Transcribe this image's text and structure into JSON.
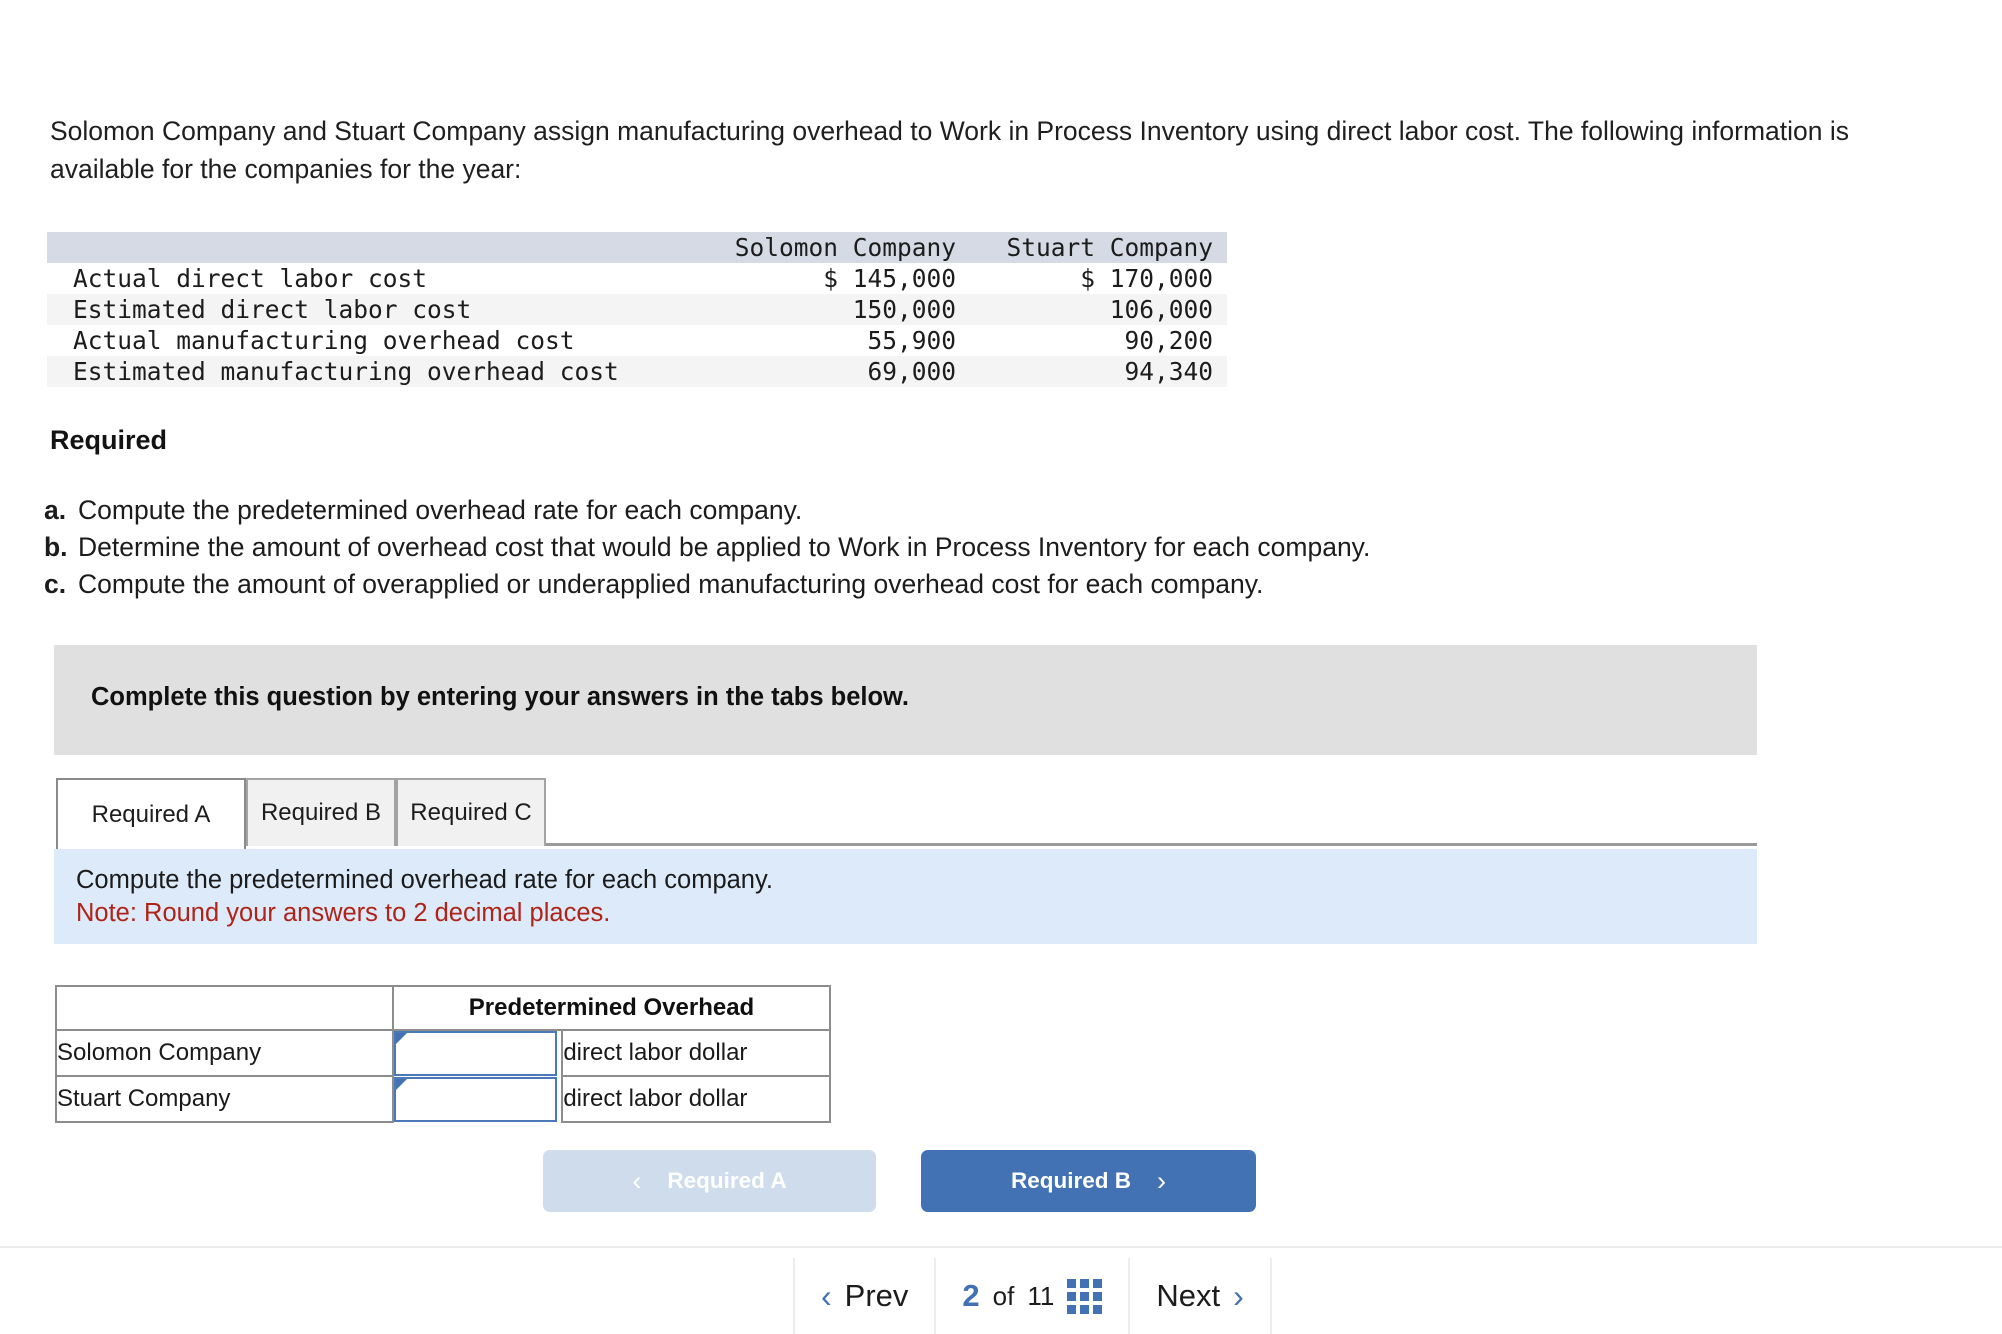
{
  "intro": {
    "paragraph": "Solomon Company and Stuart Company assign manufacturing overhead to Work in Process Inventory using direct labor cost. The following information is available for the companies for the year:"
  },
  "fact_table": {
    "columns": [
      "",
      "Solomon Company",
      "Stuart Company"
    ],
    "rows": [
      {
        "label": "Actual direct labor cost",
        "solomon": "$ 145,000",
        "stuart": "$ 170,000"
      },
      {
        "label": "Estimated direct labor cost",
        "solomon": "150,000",
        "stuart": "106,000"
      },
      {
        "label": "Actual manufacturing overhead cost",
        "solomon": "55,900",
        "stuart": "90,200"
      },
      {
        "label": "Estimated manufacturing overhead cost",
        "solomon": "69,000",
        "stuart": "94,340"
      }
    ]
  },
  "required": {
    "title": "Required",
    "items": [
      {
        "letter": "a.",
        "text": "Compute the predetermined overhead rate for each company."
      },
      {
        "letter": "b.",
        "text": "Determine the amount of overhead cost that would be applied to Work in Process Inventory for each company."
      },
      {
        "letter": "c.",
        "text": "Compute the amount of overapplied or underapplied manufacturing overhead cost for each company."
      }
    ]
  },
  "banner": {
    "text": "Complete this question by entering your answers in the tabs below."
  },
  "tabs": [
    {
      "label": "Required A",
      "active": true
    },
    {
      "label": "Required B",
      "active": false
    },
    {
      "label": "Required C",
      "active": false
    }
  ],
  "info_panel": {
    "instruction": "Compute the predetermined overhead rate for each company.",
    "note": "Note: Round your answers to 2 decimal places.",
    "note_color": "#b02318",
    "background": "#dceafa"
  },
  "answer_table": {
    "header_blank": "",
    "header_title": "Predetermined Overhead",
    "header_background": "#82aade",
    "rows": [
      {
        "company": "Solomon Company",
        "value": "",
        "unit": "direct labor dollar"
      },
      {
        "company": "Stuart Company",
        "value": "",
        "unit": "direct labor dollar"
      }
    ]
  },
  "nav_pills": {
    "prev": {
      "label": "Required A",
      "icon": "chevron-left-icon",
      "glyph": "‹",
      "background": "#cfdcec"
    },
    "next": {
      "label": "Required B",
      "icon": "chevron-right-icon",
      "glyph": "›",
      "background": "#4272b4"
    }
  },
  "pager": {
    "prev_label": "Prev",
    "prev_glyph": "‹",
    "current_page": "2",
    "of_label": "of",
    "total_pages": "11",
    "grid_icon": "grid-icon",
    "next_label": "Next",
    "next_glyph": "›",
    "accent_color": "#4272b4"
  }
}
